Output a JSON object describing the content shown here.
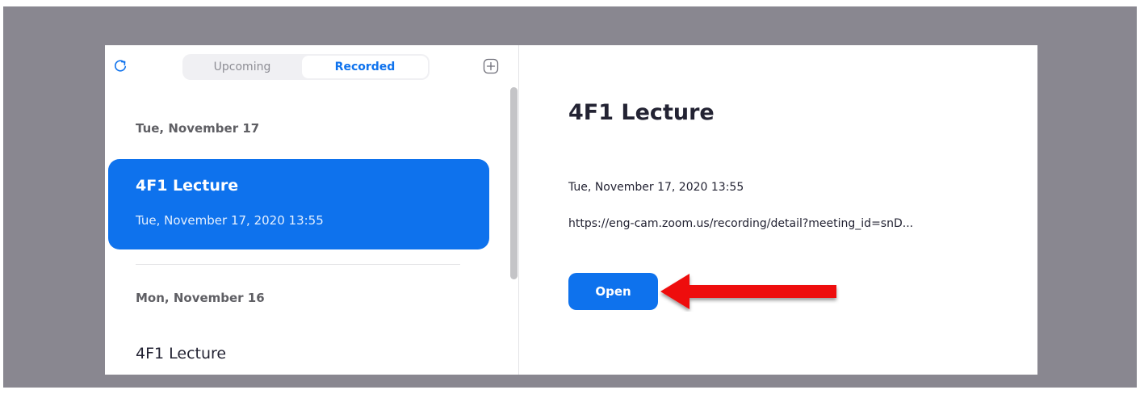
{
  "tabs": {
    "upcoming": "Upcoming",
    "recorded": "Recorded"
  },
  "icons": {
    "refresh": "refresh-icon",
    "add": "add-icon"
  },
  "list": {
    "groups": [
      {
        "date": "Tue, November 17"
      },
      {
        "date": "Mon, November 16"
      }
    ],
    "selected_item": {
      "title": "4F1 Lecture",
      "time": "Tue, November 17, 2020 13:55"
    },
    "next_item": {
      "title": "4F1 Lecture"
    }
  },
  "detail": {
    "title": "4F1 Lecture",
    "time": "Tue, November 17, 2020 13:55",
    "url": "https://eng-cam.zoom.us/recording/detail?meeting_id=snD...",
    "open_button": "Open"
  },
  "colors": {
    "accent": "#0e72ed",
    "backdrop": "#898790",
    "annotation_arrow": "#ee0f0f"
  }
}
